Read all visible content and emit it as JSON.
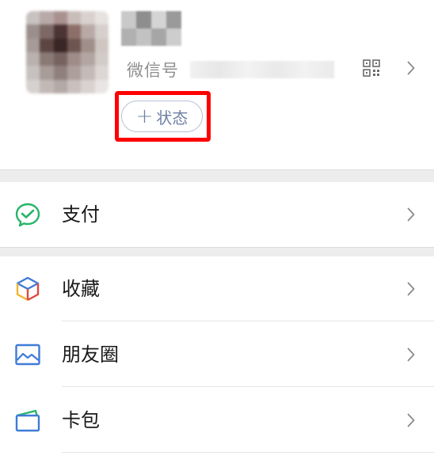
{
  "profile": {
    "wechat_id_label": "微信号",
    "status_button_plus": "+",
    "status_button_label": "状态"
  },
  "icons": {
    "qr": "qr-code-icon",
    "chevron": "chevron-right-icon"
  },
  "colors": {
    "pay_green": "#27b569",
    "link_blue": "#3f7bd8",
    "highlight_red": "#ff0000"
  },
  "menu": {
    "pay": {
      "label": "支付",
      "icon": "pay-icon"
    },
    "favorites": {
      "label": "收藏",
      "icon": "favorites-cube-icon"
    },
    "moments": {
      "label": "朋友圈",
      "icon": "moments-picture-icon"
    },
    "cards": {
      "label": "卡包",
      "icon": "card-wallet-icon"
    }
  }
}
